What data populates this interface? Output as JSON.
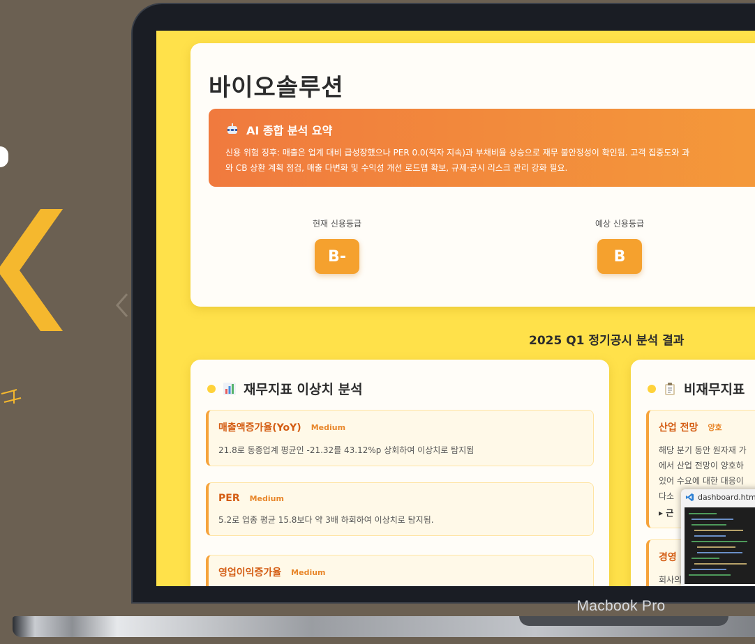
{
  "screen": {
    "company_name": "바이오솔루션",
    "ai_summary": {
      "title": "AI 종합 분석 요약",
      "line1": "신용 위험 징후: 매출은 업계 대비 급성장했으나 PER 0.0(적자 지속)과 부채비율 상승으로 재무 불안정성이 확인됨. 고객 집중도와 과",
      "line2": "와 CB 상환 계획 점검, 매출 다변화 및 수익성 개선 로드맵 확보, 규제·공시 리스크 관리 강화 필요."
    },
    "grades": {
      "current_label": "현재 신용등급",
      "current_value": "B-",
      "expected_label": "예상 신용등급",
      "expected_value": "B"
    },
    "section_heading": "2025 Q1 정기공시 분석 결과",
    "financial_panel": {
      "title": "재무지표 이상치 분석",
      "items": [
        {
          "title": "매출액증가율(YoY)",
          "severity": "Medium",
          "desc": "21.8로 동종업계 평균인 -21.32를 43.12%p 상회하여 이상치로 탐지됨"
        },
        {
          "title": "PER",
          "severity": "Medium",
          "desc": "5.2로 업종 평균 15.8보다 약 3배 하회하여 이상치로 탐지됨."
        },
        {
          "title": "영업이익증가율",
          "severity": "Medium",
          "desc": ""
        }
      ]
    },
    "nonfinancial_panel": {
      "title": "비재무지표",
      "items": [
        {
          "title": "산업 전망",
          "severity": "양호",
          "lines": [
            "해당 분기 동안 원자재 가",
            "에서 산업 전망이 양호하",
            "있어 수요에 대한 대응이",
            "다소"
          ],
          "more": "▸ 근"
        },
        {
          "title": "경영",
          "severity": "",
          "lines": [
            "회사의"
          ],
          "more": ""
        }
      ]
    },
    "vscode": {
      "tab_label": "dashboard.html"
    }
  },
  "laptop": {
    "model_label": "Macbook Pro"
  }
}
